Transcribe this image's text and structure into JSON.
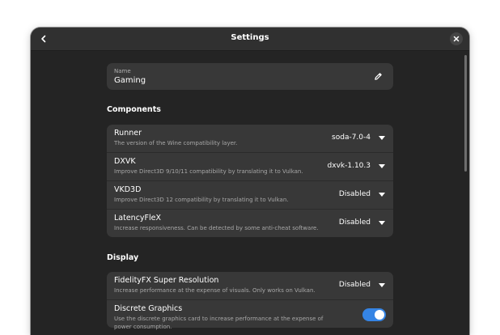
{
  "window": {
    "title": "Settings"
  },
  "name_field": {
    "label": "Name",
    "value": "Gaming"
  },
  "sections": {
    "components": {
      "title": "Components",
      "rows": [
        {
          "title": "Runner",
          "subtitle": "The version of the Wine compatibility layer.",
          "value": "soda-7.0-4"
        },
        {
          "title": "DXVK",
          "subtitle": "Improve Direct3D 9/10/11 compatibility by translating it to Vulkan.",
          "value": "dxvk-1.10.3"
        },
        {
          "title": "VKD3D",
          "subtitle": "Improve Direct3D 12 compatibility by translating it to Vulkan.",
          "value": "Disabled"
        },
        {
          "title": "LatencyFleX",
          "subtitle": "Increase responsiveness. Can be detected by some anti-cheat software.",
          "value": "Disabled"
        }
      ]
    },
    "display": {
      "title": "Display",
      "rows": [
        {
          "title": "FidelityFX Super Resolution",
          "subtitle": "Increase performance at the expense of visuals. Only works on Vulkan.",
          "value": "Disabled"
        },
        {
          "title": "Discrete Graphics",
          "subtitle": "Use the discrete graphics card to increase performance at the expense of power consumption.",
          "toggle_on": true
        }
      ]
    }
  },
  "colors": {
    "accent": "#3584e4",
    "window_bg": "#242424",
    "card_bg": "#383838"
  }
}
